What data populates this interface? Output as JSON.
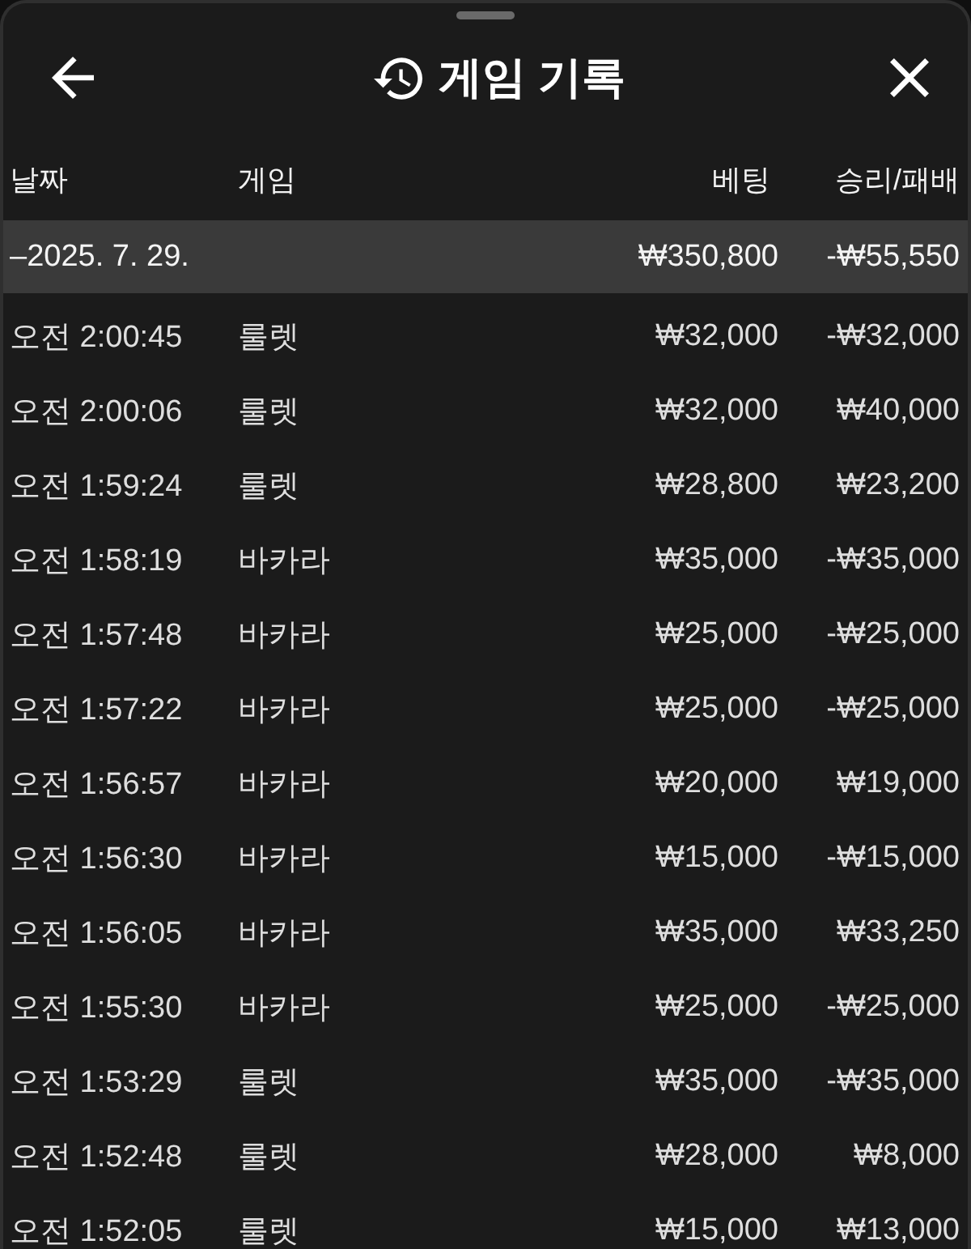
{
  "sheet": {
    "title": "게임 기록"
  },
  "table": {
    "columns": [
      "날짜",
      "게임",
      "베팅",
      "승리/패배"
    ],
    "groups": [
      {
        "date": "–2025. 7. 29.",
        "bet": "₩350,800",
        "result": "-₩55,550",
        "rows": [
          {
            "time": "오전 2:00:45",
            "game": "룰렛",
            "bet": "₩32,000",
            "result": "-₩32,000"
          },
          {
            "time": "오전 2:00:06",
            "game": "룰렛",
            "bet": "₩32,000",
            "result": "₩40,000"
          },
          {
            "time": "오전 1:59:24",
            "game": "룰렛",
            "bet": "₩28,800",
            "result": "₩23,200"
          },
          {
            "time": "오전 1:58:19",
            "game": "바카라",
            "bet": "₩35,000",
            "result": "-₩35,000"
          },
          {
            "time": "오전 1:57:48",
            "game": "바카라",
            "bet": "₩25,000",
            "result": "-₩25,000"
          },
          {
            "time": "오전 1:57:22",
            "game": "바카라",
            "bet": "₩25,000",
            "result": "-₩25,000"
          },
          {
            "time": "오전 1:56:57",
            "game": "바카라",
            "bet": "₩20,000",
            "result": "₩19,000"
          },
          {
            "time": "오전 1:56:30",
            "game": "바카라",
            "bet": "₩15,000",
            "result": "-₩15,000"
          },
          {
            "time": "오전 1:56:05",
            "game": "바카라",
            "bet": "₩35,000",
            "result": "₩33,250"
          },
          {
            "time": "오전 1:55:30",
            "game": "바카라",
            "bet": "₩25,000",
            "result": "-₩25,000"
          },
          {
            "time": "오전 1:53:29",
            "game": "룰렛",
            "bet": "₩35,000",
            "result": "-₩35,000"
          },
          {
            "time": "오전 1:52:48",
            "game": "룰렛",
            "bet": "₩28,000",
            "result": "₩8,000"
          },
          {
            "time": "오전 1:52:05",
            "game": "룰렛",
            "bet": "₩15,000",
            "result": "₩13,000"
          }
        ]
      }
    ]
  }
}
